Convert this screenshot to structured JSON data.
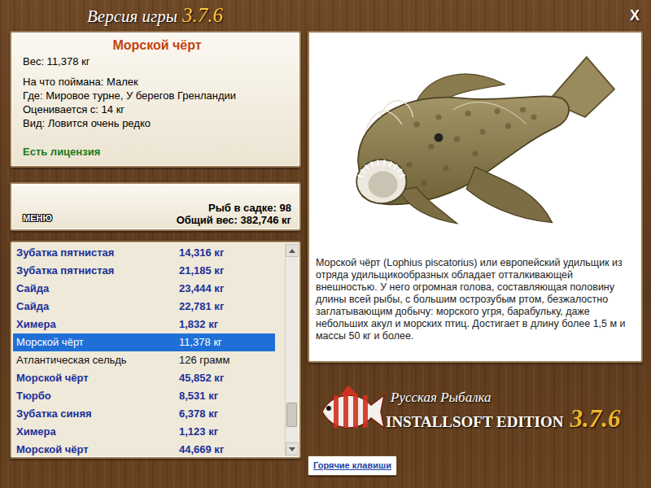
{
  "window": {
    "title": "Версия игры",
    "version": "3.7.6",
    "close": "X"
  },
  "fish": {
    "name": "Морской чёрт",
    "weight": "Вес: 11,378 кг",
    "details": [
      "На что поймана: Малек",
      "Где: Мировое турне, У берегов Гренландии",
      "Оценивается с: 14 кг",
      "Вид: Ловится очень редко"
    ],
    "license": "Есть лицензия",
    "description": "Морской чёрт (Lophius piscatorius) или европейский удильщик из отряда удильщикообразных обладает отталкивающей внешностью. У него огромная голова, составляющая половину длины всей рыбы, с большим острозубым ртом, безжалостно заглатывающим добычу: морского угря, барабульку, даже небольших акул и морских птиц. Достигает в длину более 1,5 м и массы 50 кг и более."
  },
  "keepnet": {
    "menu": "МЕНЮ",
    "count": "Рыб в садке: 98",
    "total": "Общий вес: 382,746 кг"
  },
  "catch_list": {
    "rows": [
      {
        "name": "Зубатка пятнистая",
        "weight": "14,316 кг",
        "bold": true,
        "selected": false
      },
      {
        "name": "Зубатка пятнистая",
        "weight": "21,185 кг",
        "bold": true,
        "selected": false
      },
      {
        "name": "Сайда",
        "weight": "23,444 кг",
        "bold": true,
        "selected": false
      },
      {
        "name": "Сайда",
        "weight": "22,781 кг",
        "bold": true,
        "selected": false
      },
      {
        "name": "Химера",
        "weight": "1,832 кг",
        "bold": true,
        "selected": false
      },
      {
        "name": "Морской чёрт",
        "weight": "11,378 кг",
        "bold": false,
        "selected": true
      },
      {
        "name": "Атлантическая сельдь",
        "weight": "126 грамм",
        "bold": false,
        "selected": false
      },
      {
        "name": "Морской чёрт",
        "weight": "45,852 кг",
        "bold": true,
        "selected": false
      },
      {
        "name": "Тюрбо",
        "weight": "8,531 кг",
        "bold": true,
        "selected": false
      },
      {
        "name": "Зубатка синяя",
        "weight": "6,378 кг",
        "bold": true,
        "selected": false
      },
      {
        "name": "Химера",
        "weight": "1,123 кг",
        "bold": true,
        "selected": false
      },
      {
        "name": "Морской чёрт",
        "weight": "44,669 кг",
        "bold": true,
        "selected": false
      }
    ],
    "scrollbar": {
      "level": 0.93
    }
  },
  "logo": {
    "title": "Русская Рыбалка",
    "edition": "INSTALLSOFT EDITION",
    "version": "3.7.6"
  },
  "hotkeys": "Горячие клавиши"
}
